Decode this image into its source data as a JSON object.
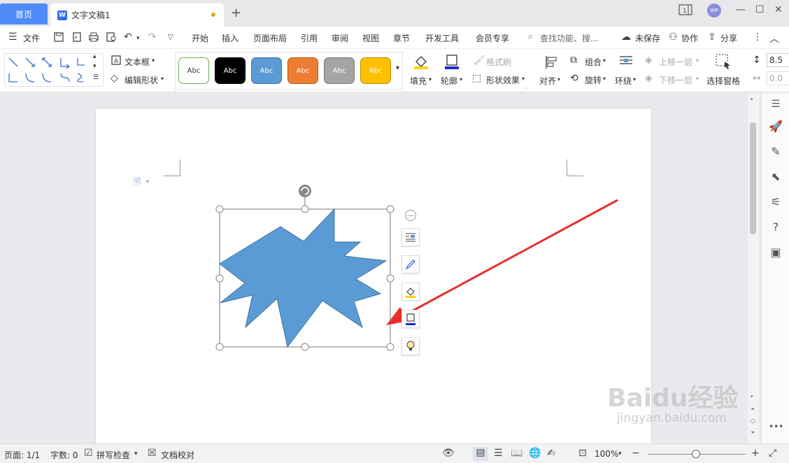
{
  "tabs": {
    "home": "首页",
    "document": "文字文稿1",
    "new_tab": "+"
  },
  "titlebar": {
    "avatar_text": "WP",
    "minimize": "—",
    "maximize": "☐",
    "close": "✕"
  },
  "menu": {
    "file": "文件",
    "items": [
      "开始",
      "插入",
      "页面布局",
      "引用",
      "审阅",
      "视图",
      "章节",
      "开发工具",
      "会员专享"
    ],
    "search_placeholder": "查找功能、搜...",
    "unsaved": "未保存",
    "collaborate": "协作",
    "share": "分享"
  },
  "ribbon": {
    "textbox": "文本框",
    "edit_shape": "编辑形状",
    "styles": [
      {
        "label": "Abc",
        "bg": "#ffffff",
        "border": "#70ad47",
        "color": "#333333"
      },
      {
        "label": "Abc",
        "bg": "#000000",
        "border": "#000000",
        "color": "#ffffff"
      },
      {
        "label": "Abc",
        "bg": "#5b9bd5",
        "border": "#41719c",
        "color": "#ffffff"
      },
      {
        "label": "Abc",
        "bg": "#ed7d31",
        "border": "#ae5a21",
        "color": "#ffffff"
      },
      {
        "label": "Abc",
        "bg": "#a5a5a5",
        "border": "#787878",
        "color": "#ffffff"
      },
      {
        "label": "Abc",
        "bg": "#ffc000",
        "border": "#bc8c00",
        "color": "#ffffff"
      }
    ],
    "fill": "填充",
    "outline": "轮廓",
    "format_brush": "格式刷",
    "shape_effects": "形状效果",
    "align": "对齐",
    "group": "组合",
    "rotate": "旋转",
    "wrap": "环绕",
    "bring_forward": "上移一层",
    "send_backward": "下移一层",
    "selection_pane": "选择窗格",
    "size_height": "8.5",
    "size_width": "0.0"
  },
  "colors": {
    "shape_fill": "#5b9bd5",
    "shape_stroke": "#41719c",
    "accent": "#4f8bf7",
    "arrow": "#e8302a"
  },
  "status": {
    "page": "页面: 1/1",
    "words": "字数: 0",
    "spell_check": "拼写检查",
    "doc_proof": "文档校对",
    "zoom": "100%"
  },
  "watermark": {
    "main": "Baidu经验",
    "sub": "jingyan.baidu.com"
  }
}
